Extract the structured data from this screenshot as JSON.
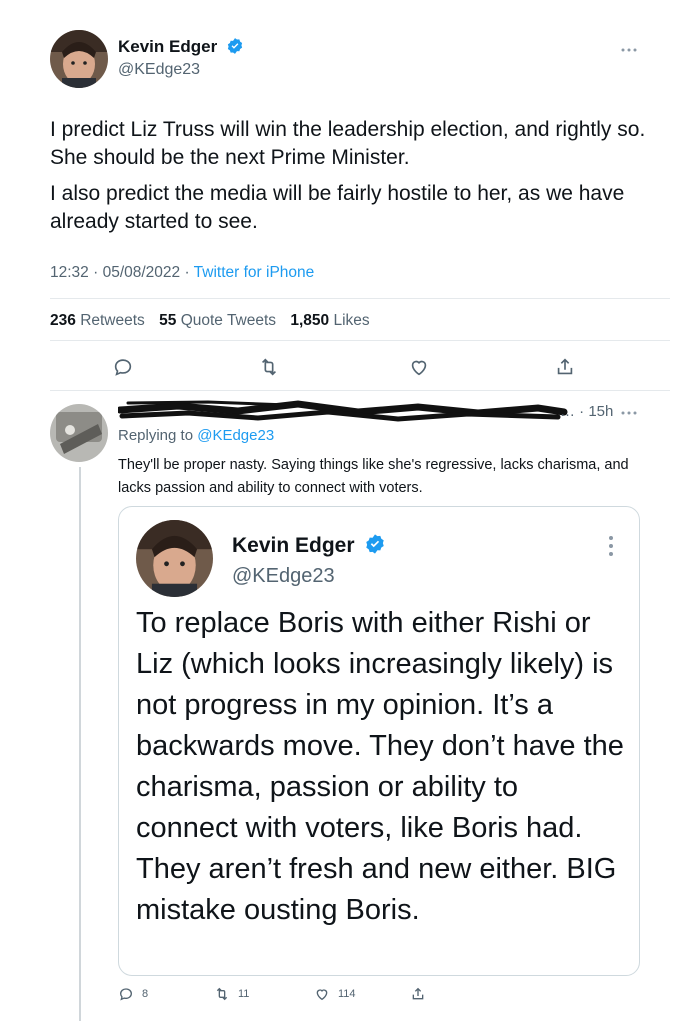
{
  "main_tweet": {
    "author_name": "Kevin Edger",
    "author_handle": "@KEdge23",
    "paragraph_1": "I predict Liz Truss will win the leadership election, and rightly so. She should be the next Prime Minister.",
    "paragraph_2": "I also predict the media will be fairly hostile to her, as we have already started to see.",
    "time": "12:32",
    "date": "05/08/2022",
    "source": "Twitter for iPhone",
    "retweets_count": "236",
    "retweets_label": "Retweets",
    "quotes_count": "55",
    "quotes_label": "Quote Tweets",
    "likes_count": "1,850",
    "likes_label": "Likes"
  },
  "reply": {
    "age": "15h",
    "replying_prefix": "Replying to",
    "replying_handle": "@KEdge23",
    "text": "They'll be proper nasty. Saying things like she's regressive, lacks charisma, and lacks passion and ability to connect with voters.",
    "reply_count": "8",
    "retweet_count": "11",
    "like_count": "114"
  },
  "quoted_tweet": {
    "author_name": "Kevin Edger",
    "author_handle": "@KEdge23",
    "text": "To replace Boris with either Rishi or Liz (which looks increasingly likely) is not progress in my opinion. It’s a backwards move. They don’t have the charisma, passion or ability to connect with voters, like Boris had. They aren’t fresh and new either. BIG mistake ousting Boris."
  },
  "icons": [
    "more-icon",
    "verified-icon",
    "reply-icon",
    "retweet-icon",
    "like-icon",
    "share-icon"
  ],
  "colors": {
    "accent": "#1d9bf0",
    "muted": "#536471",
    "text": "#0f1419",
    "divider": "#e5e9ec"
  }
}
